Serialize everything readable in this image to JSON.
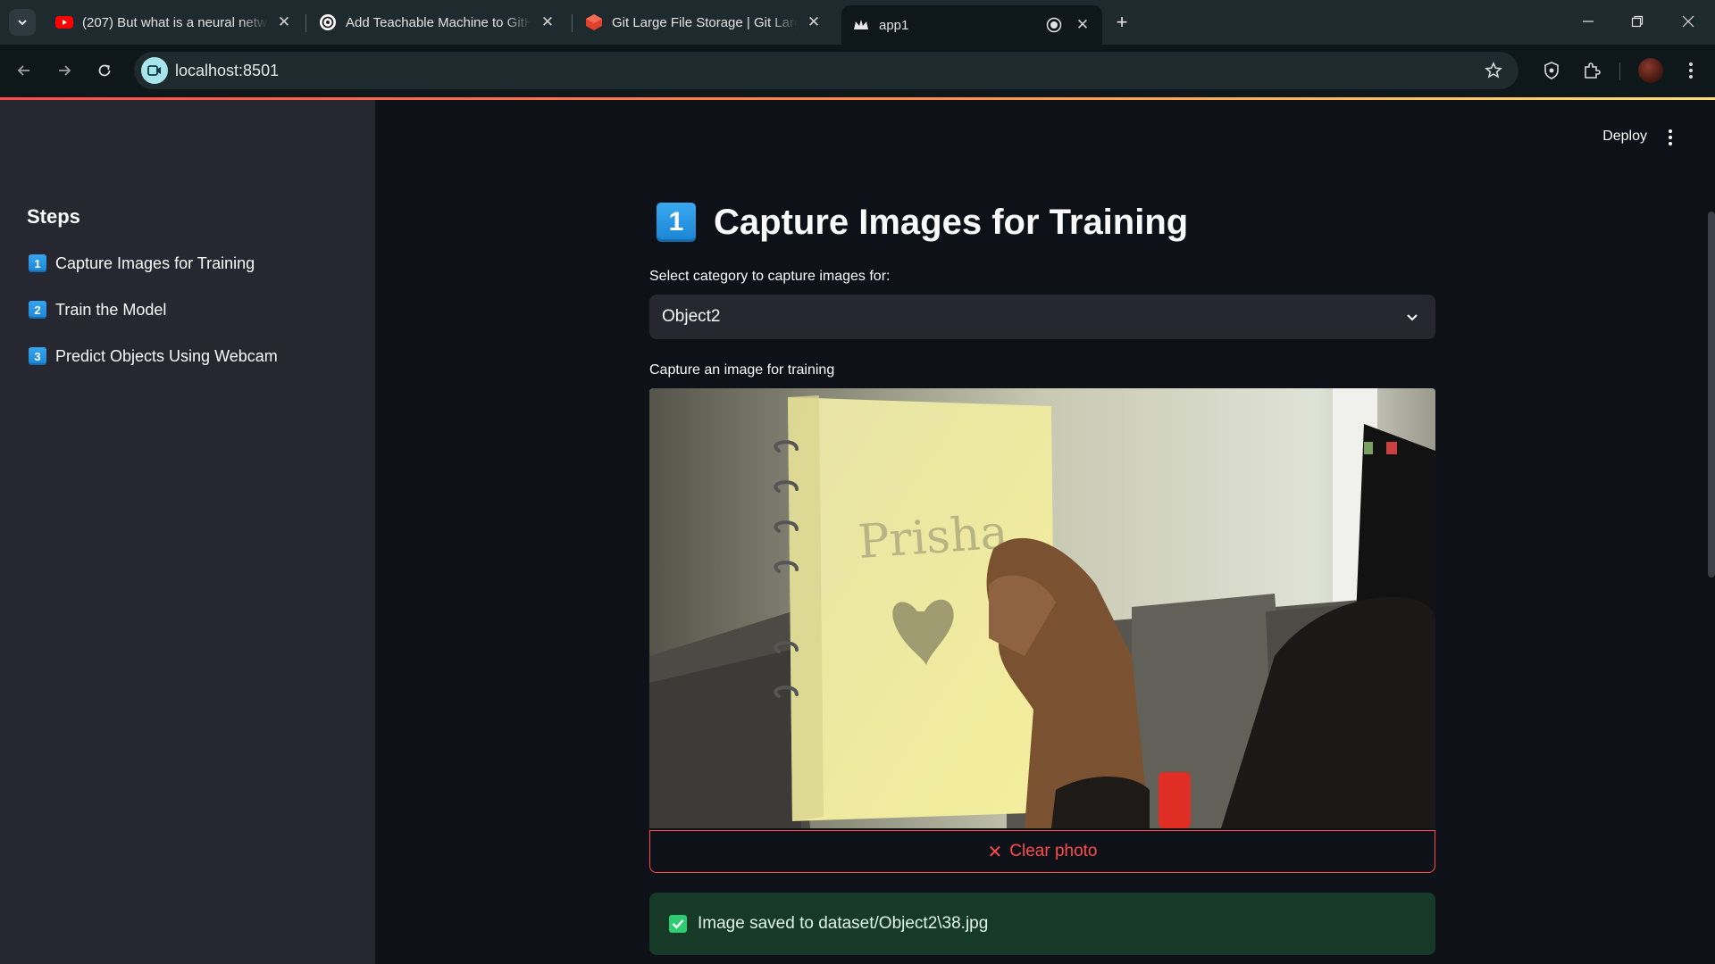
{
  "browser": {
    "tabs": [
      {
        "title": "(207) But what is a neural netw",
        "favicon": "youtube-icon"
      },
      {
        "title": "Add Teachable Machine to GitH",
        "favicon": "openai-icon"
      },
      {
        "title": "Git Large File Storage | Git Larg",
        "favicon": "git-lfs-icon"
      },
      {
        "title": "app1",
        "favicon": "streamlit-crown-icon",
        "active": true
      }
    ],
    "url": "localhost:8501"
  },
  "app": {
    "sidebar": {
      "title": "Steps",
      "items": [
        {
          "key": "1",
          "label": "Capture Images for Training"
        },
        {
          "key": "2",
          "label": "Train the Model"
        },
        {
          "key": "3",
          "label": "Predict Objects Using Webcam"
        }
      ]
    },
    "header": {
      "deploy_label": "Deploy"
    },
    "main": {
      "heading_key": "1",
      "heading": "Capture Images for Training",
      "select_label": "Select category to capture images for:",
      "select_value": "Object2",
      "camera_label": "Capture an image for training",
      "photo_handwriting": "Prisha",
      "clear_label": "Clear photo",
      "success_message": "Image saved to dataset/Object2\\38.jpg"
    }
  },
  "colors": {
    "accent": "#ff4b4b",
    "success_bg": "#173928",
    "sidebar_bg": "#262730",
    "main_bg": "#0e1117"
  }
}
